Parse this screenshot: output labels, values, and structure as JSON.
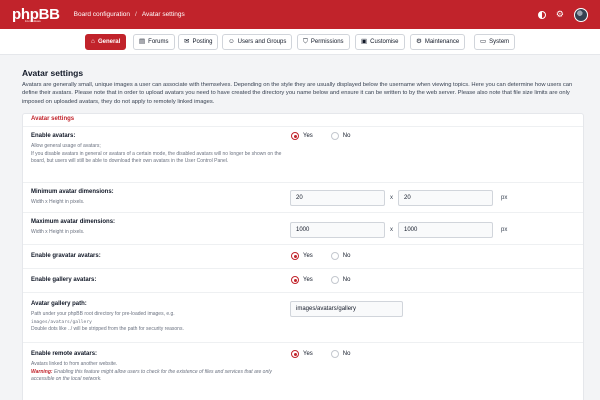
{
  "header": {
    "logo": "phpBB",
    "logo_sub": "forum software",
    "breadcrumb": [
      "Board configuration",
      "Avatar settings"
    ],
    "icons": [
      "contrast-icon",
      "gear-icon",
      "user-avatar"
    ]
  },
  "tabs": [
    {
      "label": "General",
      "icon": "home-icon",
      "glyph": "⌂",
      "active": true
    },
    {
      "label": "Forums",
      "icon": "forums-icon",
      "glyph": "▤",
      "active": false
    },
    {
      "label": "Posting",
      "icon": "posting-icon",
      "glyph": "✉",
      "active": false
    },
    {
      "label": "Users and Groups",
      "icon": "users-icon",
      "glyph": "☺",
      "active": false
    },
    {
      "label": "Permissions",
      "icon": "shield-icon",
      "glyph": "⛉",
      "active": false
    },
    {
      "label": "Customise",
      "icon": "customise-icon",
      "glyph": "▣",
      "active": false
    },
    {
      "label": "Maintenance",
      "icon": "maintenance-icon",
      "glyph": "⚙",
      "active": false
    },
    {
      "label": "System",
      "icon": "system-icon",
      "glyph": "▭",
      "active": false
    }
  ],
  "page": {
    "title": "Avatar settings",
    "description": "Avatars are generally small, unique images a user can associate with themselves. Depending on the style they are usually displayed below the username when viewing topics. Here you can determine how users can define their avatars. Please note that in order to upload avatars you need to have created the directory you name below and ensure it can be written to by the web server. Please also note that file size limits are only imposed on uploaded avatars, they do not apply to remotely linked images."
  },
  "panel": {
    "legend": "Avatar settings",
    "yes_label": "Yes",
    "no_label": "No",
    "x_label": "x",
    "unit_px": "px",
    "enable_avatars": {
      "label": "Enable avatars:",
      "help_1": "Allow general usage of avatars;",
      "help_2": "If you disable avatars in general or avatars of a certain mode, the disabled avatars will no longer be shown on the board, but users will still be able to download their own avatars in the User Control Panel.",
      "selected": "yes"
    },
    "min_dims": {
      "label": "Minimum avatar dimensions:",
      "help": "Width x Height in pixels.",
      "width": "20",
      "height": "20"
    },
    "max_dims": {
      "label": "Maximum avatar dimensions:",
      "help": "Width x Height in pixels.",
      "width": "1000",
      "height": "1000"
    },
    "gravatar": {
      "label": "Enable gravatar avatars:",
      "selected": "yes"
    },
    "gallery": {
      "label": "Enable gallery avatars:",
      "selected": "yes"
    },
    "gallery_path": {
      "label": "Avatar gallery path:",
      "help_1": "Path under your phpBB root directory for pre-loaded images, e.g.",
      "help_code": "images/avatars/gallery",
      "help_2": "Double dots like ../ will be stripped from the path for security reasons.",
      "value": "images/avatars/gallery"
    },
    "remote": {
      "label": "Enable remote avatars:",
      "help_1": "Avatars linked to from another website.",
      "warn": "Warning:",
      "warn_text": "Enabling this feature might allow users to check for the existence of files and services that are only accessible on the local network.",
      "selected": "yes"
    }
  },
  "colors": {
    "brand": "#c1232b"
  }
}
